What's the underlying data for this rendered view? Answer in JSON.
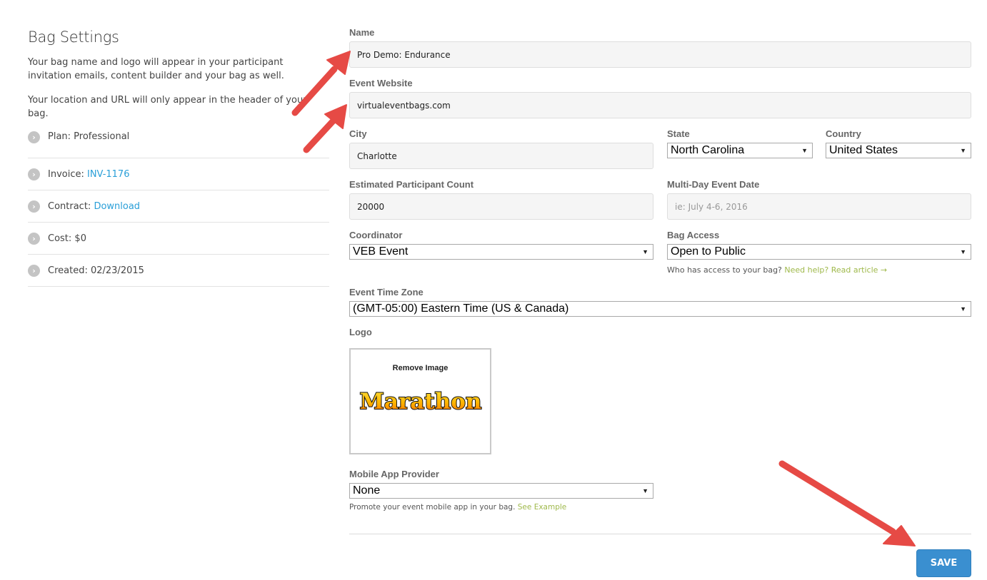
{
  "sidebar": {
    "title": "Bag Settings",
    "description_1": "Your bag name and logo will appear in your participant invitation emails, content builder and your bag as well.",
    "description_2": "Your location and URL will only appear in the header of your bag.",
    "items": [
      {
        "label": "Plan: ",
        "value": "Professional",
        "link": false
      },
      {
        "label": "Invoice: ",
        "value": "INV-1176",
        "link": true
      },
      {
        "label": "Contract: ",
        "value": "Download",
        "link": true
      },
      {
        "label": "Cost: ",
        "value": "$0",
        "link": false
      },
      {
        "label": "Created: ",
        "value": "02/23/2015",
        "link": false
      }
    ],
    "chevron_icon": "›"
  },
  "form": {
    "name": {
      "label": "Name",
      "value": "Pro Demo: Endurance"
    },
    "website": {
      "label": "Event Website",
      "value": "virtualeventbags.com"
    },
    "city": {
      "label": "City",
      "value": "Charlotte"
    },
    "state": {
      "label": "State",
      "value": "North Carolina"
    },
    "country": {
      "label": "Country",
      "value": "United States"
    },
    "participant_count": {
      "label": "Estimated Participant Count",
      "value": "20000"
    },
    "event_date": {
      "label": "Multi-Day Event Date",
      "placeholder": "ie: July 4-6, 2016"
    },
    "coordinator": {
      "label": "Coordinator",
      "value": "VEB Event"
    },
    "bag_access": {
      "label": "Bag Access",
      "value": "Open to Public",
      "help_text": "Who has access to your bag? ",
      "help_link": "Need help? Read article →"
    },
    "time_zone": {
      "label": "Event Time Zone",
      "value": "(GMT-05:00) Eastern Time (US & Canada)"
    },
    "logo": {
      "label": "Logo",
      "remove_label": "Remove Image",
      "image_text": "Marathon"
    },
    "mobile_app": {
      "label": "Mobile App Provider",
      "value": "None",
      "help_text": "Promote your event mobile app in your bag. ",
      "help_link": "See Example"
    },
    "dropdown_arrow": "▼"
  },
  "actions": {
    "save_label": "SAVE"
  },
  "colors": {
    "link_blue": "#2a9fd8",
    "help_green": "#9fb94b",
    "save_blue": "#3a8fd0",
    "annotation_red": "#e64a45"
  }
}
